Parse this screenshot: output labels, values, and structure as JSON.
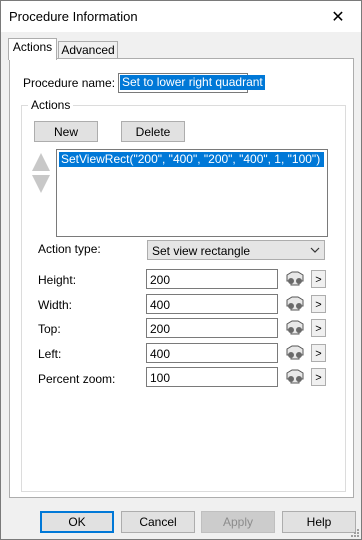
{
  "window": {
    "title": "Procedure Information",
    "close_glyph": "✕"
  },
  "tabs": [
    {
      "label": "Actions",
      "active": true
    },
    {
      "label": "Advanced",
      "active": false
    }
  ],
  "procedure": {
    "name_label": "Procedure name:",
    "name_value": "Set to lower right quadrant"
  },
  "actions": {
    "group_label": "Actions",
    "new_label": "New",
    "delete_label": "Delete",
    "list": [
      "SetViewRect(\"200\", \"400\", \"200\", \"400\", 1, \"100\")"
    ],
    "action_type_label": "Action type:",
    "action_type_value": "Set view rectangle"
  },
  "params": [
    {
      "label": "Height:",
      "value": "200"
    },
    {
      "label": "Width:",
      "value": "400"
    },
    {
      "label": "Top:",
      "value": "200"
    },
    {
      "label": "Left:",
      "value": "400"
    },
    {
      "label": "Percent zoom:",
      "value": "100"
    }
  ],
  "more_glyph": ">",
  "footer": {
    "ok": "OK",
    "cancel": "Cancel",
    "apply": "Apply",
    "help": "Help"
  },
  "colors": {
    "accent": "#0078d7"
  }
}
